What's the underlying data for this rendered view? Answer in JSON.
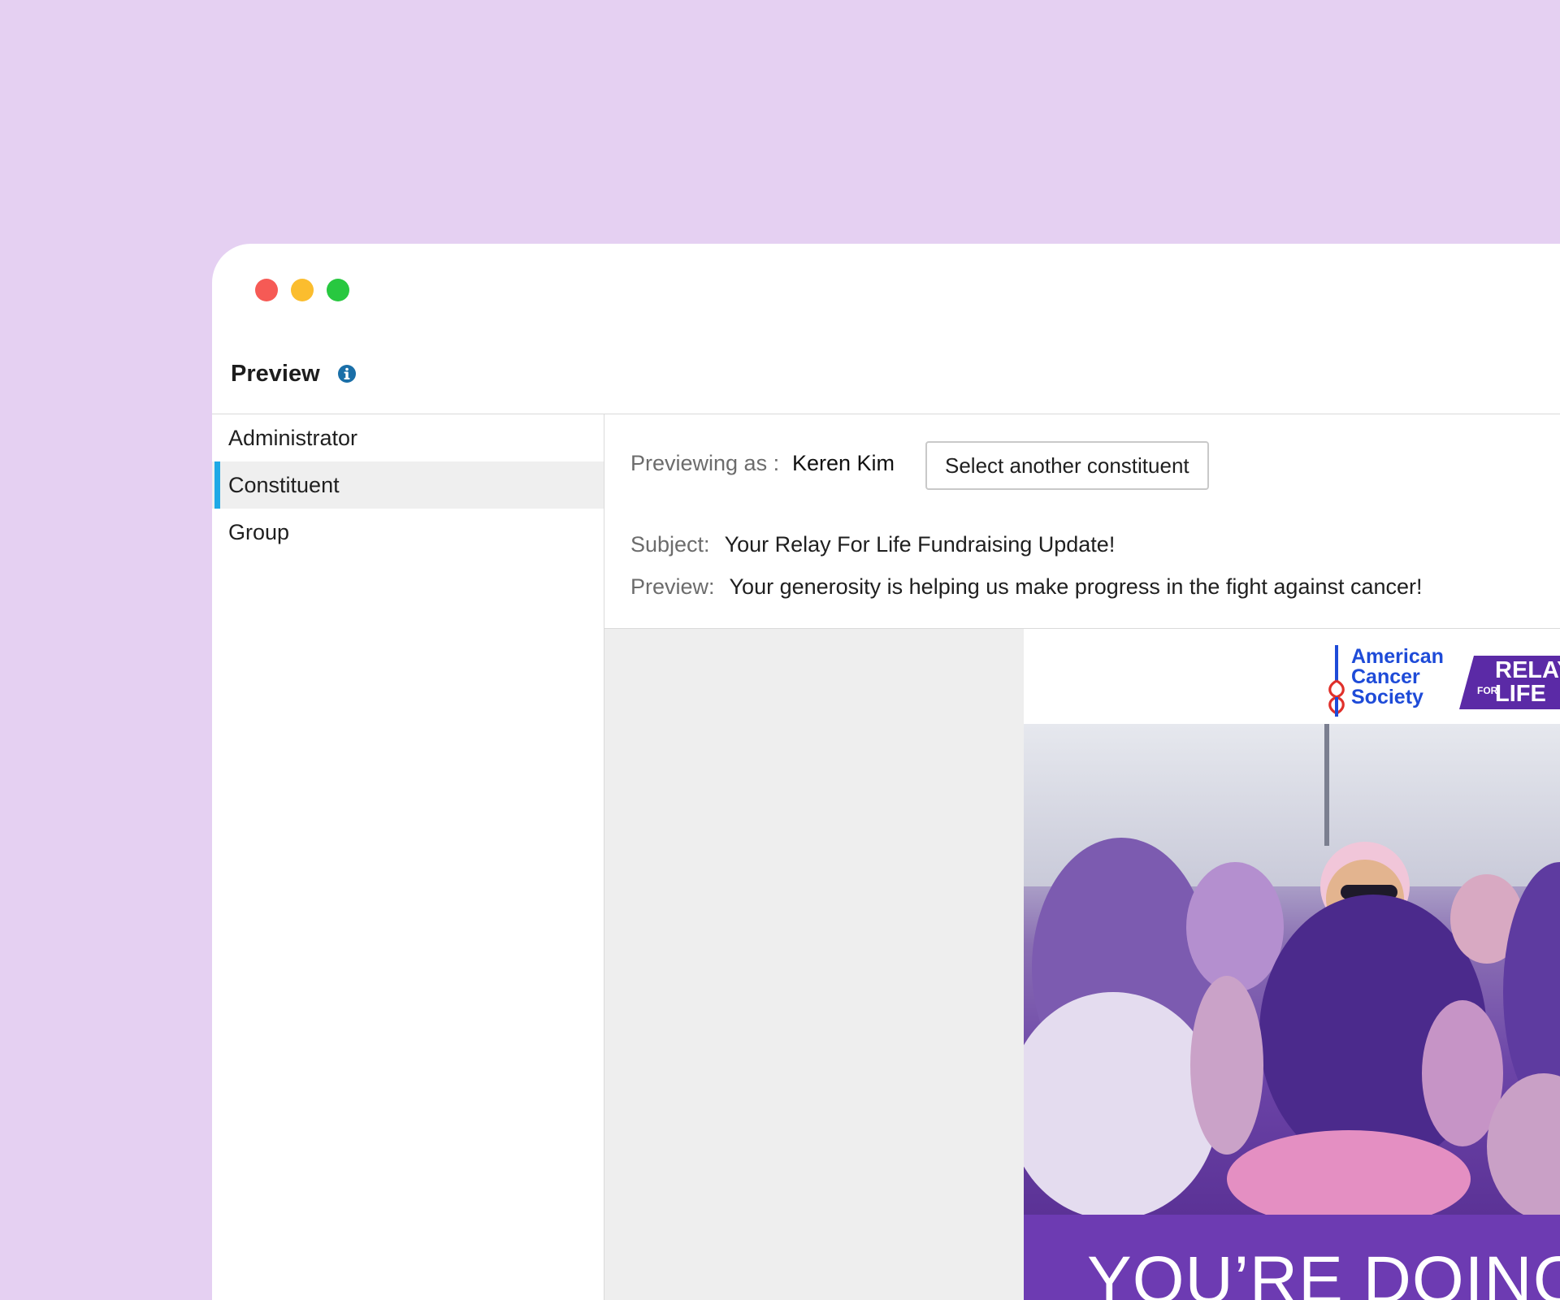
{
  "window": {
    "controls": [
      "close",
      "minimize",
      "zoom"
    ]
  },
  "header": {
    "title": "Preview",
    "info_icon": "info-icon"
  },
  "sidebar": {
    "items": [
      {
        "label": "Administrator",
        "active": false
      },
      {
        "label": "Constituent",
        "active": true
      },
      {
        "label": "Group",
        "active": false
      }
    ]
  },
  "preview": {
    "previewing_as_label": "Previewing as :",
    "previewing_as_name": "Keren Kim",
    "select_button": "Select another constituent",
    "subject_label": "Subject:",
    "subject_value": "Your Relay For Life Fundraising Update!",
    "preview_label": "Preview:",
    "preview_value": "Your generosity is helping us make progress in the fight against cancer!"
  },
  "email": {
    "logo_acs_line1": "American",
    "logo_acs_line2": "Cancer",
    "logo_acs_line3": "Society",
    "logo_relay_top": "RELAY",
    "logo_relay_for": "FOR",
    "logo_relay_life": "LIFE",
    "banner_text": "YOU’RE DOING"
  },
  "colors": {
    "background": "#e5d0f2",
    "accent": "#1fa9e6",
    "info_icon": "#1a6fa8",
    "acs_blue": "#1e4bd8",
    "relay_purple": "#5b2aa6"
  }
}
